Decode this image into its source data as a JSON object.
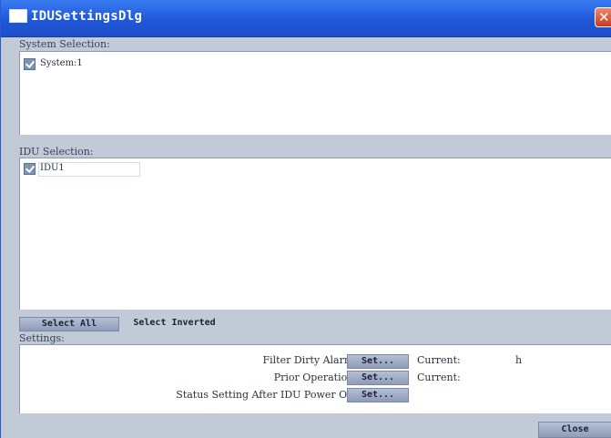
{
  "window": {
    "title": "IDUSettingsDlg",
    "close_glyph": "✕"
  },
  "system_selection": {
    "label": "System Selection:",
    "items": [
      {
        "label": "System:1",
        "checked": true
      }
    ]
  },
  "idu_selection": {
    "label": "IDU Selection:",
    "items": [
      {
        "label": "IDU1",
        "checked": true
      }
    ]
  },
  "selection_buttons": {
    "select_all": "Select All",
    "select_inverted": "Select Inverted"
  },
  "settings": {
    "label": "Settings:",
    "rows": [
      {
        "label": "Filter Dirty Alarm:",
        "button": "Set...",
        "current_label": "Current:",
        "current_value": "h"
      },
      {
        "label": "Prior Operation:",
        "button": "Set...",
        "current_label": "Current:",
        "current_value": ""
      },
      {
        "label": "Status Setting After IDU Power On:",
        "button": "Set..."
      }
    ]
  },
  "footer": {
    "close": "Close"
  },
  "colors": {
    "titlebar": "#2361e0",
    "window_bg": "#c2cad8",
    "button": "#a3b0c8"
  }
}
